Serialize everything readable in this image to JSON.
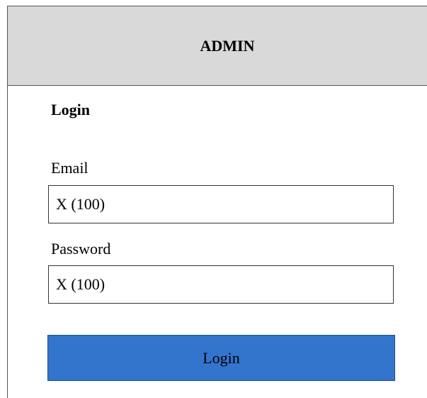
{
  "header": {
    "title": "ADMIN"
  },
  "form": {
    "title": "Login",
    "email": {
      "label": "Email",
      "value": "X (100)"
    },
    "password": {
      "label": "Password",
      "value": "X (100)"
    },
    "submit_label": "Login"
  },
  "colors": {
    "header_background": "#d9d9d9",
    "button_background": "#3374cd"
  }
}
